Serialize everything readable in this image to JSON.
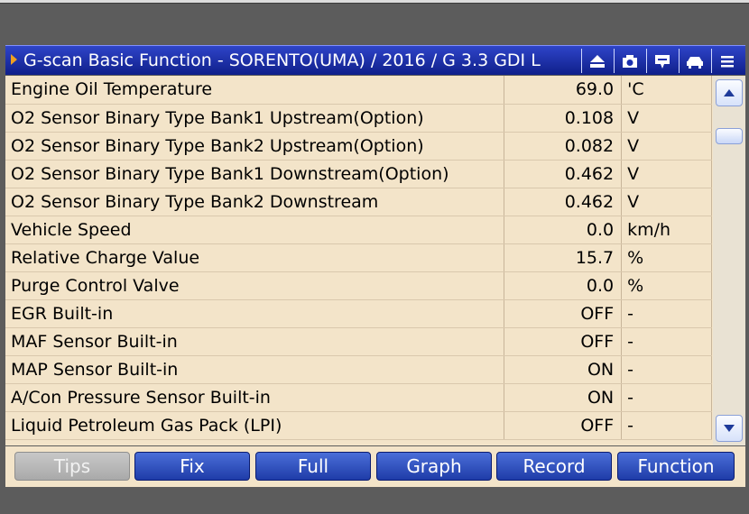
{
  "window": {
    "title": "G-scan Basic Function - SORENTO(UMA) / 2016 / G 3.3 GDI L",
    "toolbar_icons": [
      "eject-icon",
      "camera-icon",
      "comment-icon",
      "car-icon",
      "menu-icon"
    ]
  },
  "colors": {
    "titlebar": "#1a2fae",
    "panel_bg": "#f3e4c9",
    "button_blue": "#2f4fc0",
    "button_disabled": "#b8b8b8"
  },
  "parameters": [
    {
      "name": "Engine Oil Temperature",
      "value": "69.0",
      "unit": "'C"
    },
    {
      "name": "O2 Sensor Binary Type Bank1 Upstream(Option)",
      "value": "0.108",
      "unit": "V"
    },
    {
      "name": "O2 Sensor Binary Type Bank2 Upstream(Option)",
      "value": "0.082",
      "unit": "V"
    },
    {
      "name": "O2 Sensor Binary Type Bank1 Downstream(Option)",
      "value": "0.462",
      "unit": "V"
    },
    {
      "name": "O2 Sensor Binary Type Bank2 Downstream",
      "value": "0.462",
      "unit": "V"
    },
    {
      "name": "Vehicle Speed",
      "value": "0.0",
      "unit": "km/h"
    },
    {
      "name": "Relative Charge Value",
      "value": "15.7",
      "unit": "%"
    },
    {
      "name": "Purge Control Valve",
      "value": "0.0",
      "unit": "%"
    },
    {
      "name": "EGR Built-in",
      "value": "OFF",
      "unit": "-"
    },
    {
      "name": "MAF Sensor Built-in",
      "value": "OFF",
      "unit": "-"
    },
    {
      "name": "MAP Sensor Built-in",
      "value": "ON",
      "unit": "-"
    },
    {
      "name": "A/Con Pressure Sensor Built-in",
      "value": "ON",
      "unit": "-"
    },
    {
      "name": "Liquid Petroleum Gas Pack (LPI)",
      "value": "OFF",
      "unit": "-"
    }
  ],
  "bottom_buttons": [
    {
      "label": "Tips",
      "enabled": false
    },
    {
      "label": "Fix",
      "enabled": true
    },
    {
      "label": "Full",
      "enabled": true
    },
    {
      "label": "Graph",
      "enabled": true
    },
    {
      "label": "Record",
      "enabled": true
    },
    {
      "label": "Function",
      "enabled": true
    }
  ]
}
